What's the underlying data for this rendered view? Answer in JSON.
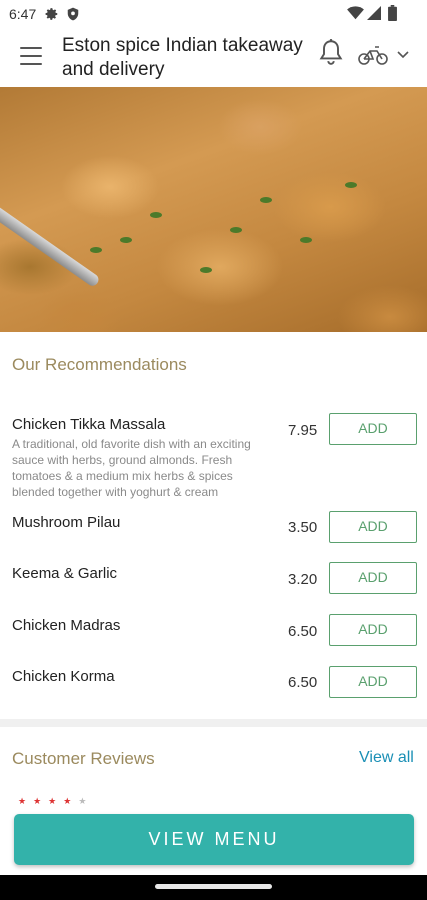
{
  "status_bar": {
    "time": "6:47",
    "icons": [
      "gear-icon",
      "shield-icon",
      "wifi-icon",
      "signal-icon",
      "battery-icon"
    ]
  },
  "app_bar": {
    "title": "Eston spice Indian takeaway and delivery",
    "icons": [
      "hamburger-menu-icon",
      "bell-icon",
      "bike-icon",
      "chevron-down-icon"
    ]
  },
  "recommendations": {
    "title": "Our Recommendations",
    "add_label": "ADD",
    "items": [
      {
        "name": "Chicken Tikka Massala",
        "description": "A traditional, old favorite dish with an exciting sauce with herbs, ground almonds. Fresh tomatoes & a medium mix herbs & spices blended together with yoghurt & cream",
        "price": "7.95"
      },
      {
        "name": "Mushroom Pilau",
        "price": "3.50"
      },
      {
        "name": "Keema & Garlic",
        "price": "3.20"
      },
      {
        "name": "Chicken Madras",
        "price": "6.50"
      },
      {
        "name": "Chicken Korma",
        "price": "6.50"
      }
    ]
  },
  "reviews": {
    "title": "Customer Reviews",
    "view_all_label": "View all",
    "rating": 4,
    "rating_max": 5
  },
  "view_menu_label": "VIEW MENU",
  "colors": {
    "accent": "#33b2aa",
    "add_button": "#5aa06e",
    "section_title": "#9b8a5e",
    "link": "#1a8fb5",
    "star": "#dd3333"
  }
}
